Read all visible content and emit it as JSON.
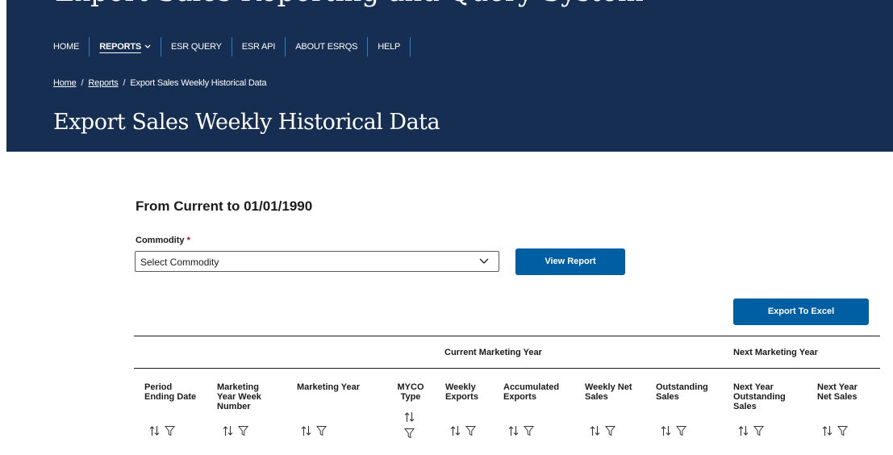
{
  "banner": {
    "partial_title": "Export Sales Reporting and Query System"
  },
  "nav": {
    "items": [
      {
        "label": "HOME"
      },
      {
        "label": "REPORTS"
      },
      {
        "label": "ESR QUERY"
      },
      {
        "label": "ESR API"
      },
      {
        "label": "ABOUT ESRQS"
      },
      {
        "label": "HELP"
      }
    ]
  },
  "breadcrumb": {
    "home": "Home",
    "reports": "Reports",
    "current": "Export Sales Weekly Historical Data",
    "separator": "/"
  },
  "page": {
    "title": "Export Sales Weekly Historical Data",
    "subtitle": "From Current to 01/01/1990"
  },
  "form": {
    "commodity_label": "Commodity",
    "required_mark": "*",
    "select_value": "Select Commodity",
    "view_button": "View Report",
    "export_button": "Export To Excel"
  },
  "table": {
    "groups": {
      "current": "Current Marketing Year",
      "next": "Next Marketing Year"
    },
    "columns": [
      {
        "label": "Period Ending Date"
      },
      {
        "label": "Marketing Year Week Number"
      },
      {
        "label": "Marketing Year"
      },
      {
        "label": "MYCO Type"
      },
      {
        "label": "Weekly Exports"
      },
      {
        "label": "Accumulated Exports"
      },
      {
        "label": "Weekly Net Sales"
      },
      {
        "label": "Outstanding Sales"
      },
      {
        "label": "Next Year Outstanding Sales"
      },
      {
        "label": "Next Year Net Sales"
      }
    ]
  },
  "colors": {
    "header_bg": "#162e51",
    "primary": "#005ea2",
    "nav_separator": "#2a7fc7",
    "required": "#b50909"
  },
  "icons": {
    "sort": "sort-arrows-icon",
    "filter": "filter-funnel-icon",
    "select": "chevron-down-icon"
  }
}
